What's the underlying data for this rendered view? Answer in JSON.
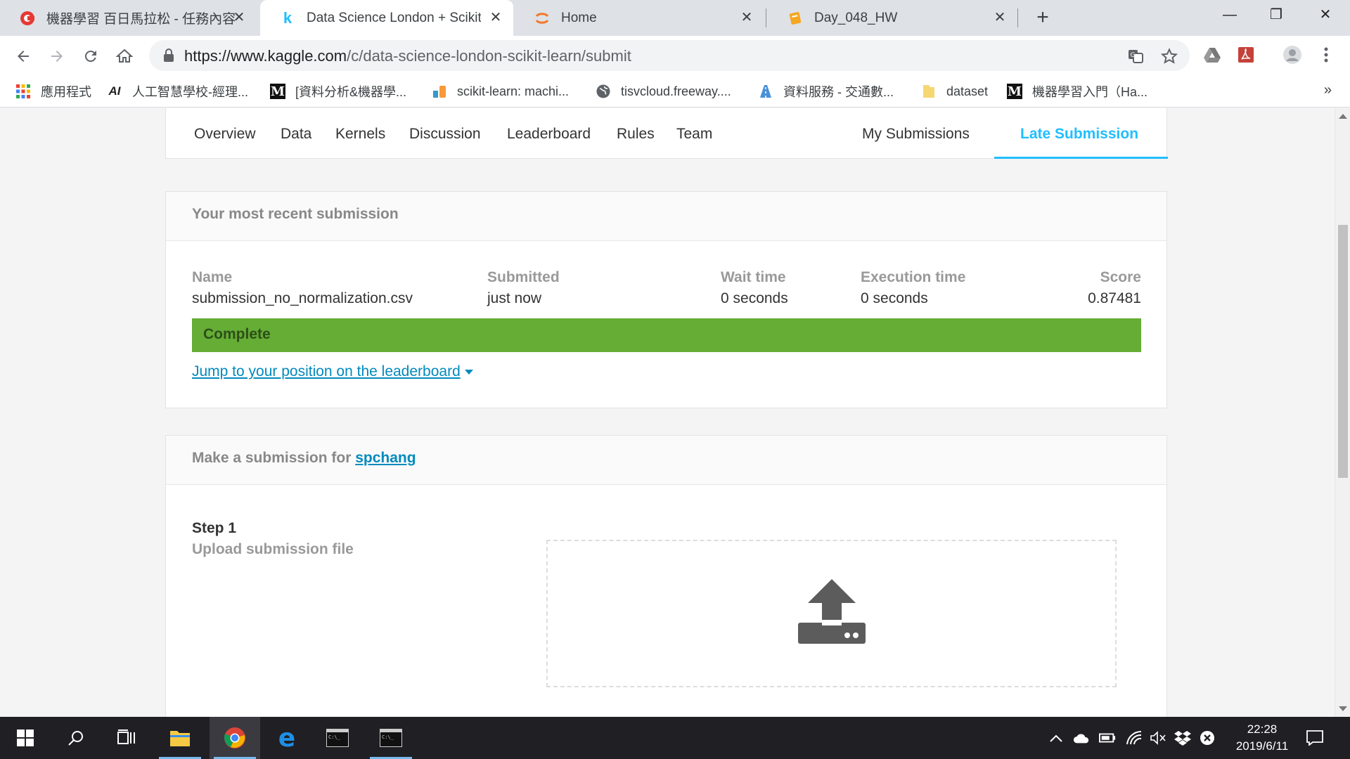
{
  "browser": {
    "tabs": [
      {
        "title": "機器學習 百日馬拉松 - 任務內容",
        "icon": "cupoy-icon",
        "active": false
      },
      {
        "title": "Data Science London + Scikit-l",
        "icon": "kaggle-icon",
        "active": true
      },
      {
        "title": "Home",
        "icon": "jupyter-icon",
        "active": false
      },
      {
        "title": "Day_048_HW",
        "icon": "notebook-icon",
        "active": false
      }
    ],
    "new_tab": "+",
    "window_controls": {
      "minimize": "—",
      "restore": "❐",
      "close": "✕"
    },
    "url": {
      "host": "https://www.kaggle.com",
      "path": "/c/data-science-london-scikit-learn/submit"
    },
    "bookmarks": [
      {
        "label": "應用程式",
        "icon": "apps-grid-icon"
      },
      {
        "label": "人工智慧學校-經理...",
        "icon": "ai-school-icon"
      },
      {
        "label": "[資料分析&機器學...",
        "icon": "medium-icon"
      },
      {
        "label": "scikit-learn: machi...",
        "icon": "scikit-icon"
      },
      {
        "label": "tisvcloud.freeway....",
        "icon": "globe-icon"
      },
      {
        "label": "資料服務 - 交通數...",
        "icon": "traffic-data-icon"
      },
      {
        "label": "dataset",
        "icon": "folder-icon"
      },
      {
        "label": "機器學習入門（Ha...",
        "icon": "medium-icon"
      }
    ],
    "bookmarks_more": "»"
  },
  "competition_nav": {
    "left": [
      "Overview",
      "Data",
      "Kernels",
      "Discussion",
      "Leaderboard",
      "Rules",
      "Team"
    ],
    "my_submissions": "My Submissions",
    "late_submission": "Late Submission",
    "active": "Late Submission"
  },
  "recent_submission": {
    "header": "Your most recent submission",
    "columns": {
      "name_label": "Name",
      "name": "submission_no_normalization.csv",
      "submitted_label": "Submitted",
      "submitted": "just now",
      "wait_label": "Wait time",
      "wait": "0 seconds",
      "exec_label": "Execution time",
      "exec": "0 seconds",
      "score_label": "Score",
      "score": "0.87481"
    },
    "status": "Complete",
    "status_color": "#65ad35",
    "jump_link": "Jump to your position on the leaderboard"
  },
  "make_submission": {
    "header_prefix": "Make a submission for ",
    "user": "spchang",
    "step_title": "Step 1",
    "step_subtitle": "Upload submission file",
    "upload_icon": "upload-icon"
  },
  "taskbar": {
    "clock_time": "22:28",
    "clock_date": "2019/6/11"
  },
  "colors": {
    "kaggle_blue": "#20beff",
    "link_blue": "#008abc"
  }
}
